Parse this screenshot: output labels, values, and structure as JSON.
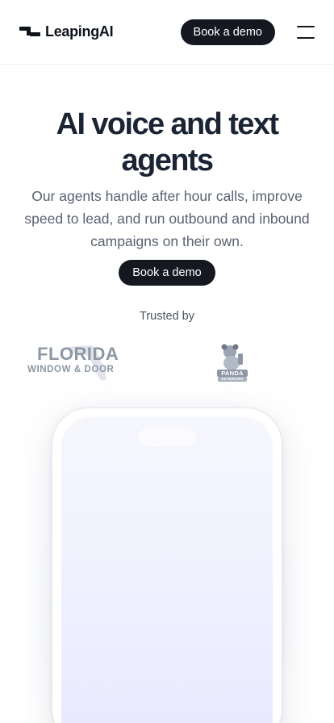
{
  "header": {
    "brand": "LeapingAI",
    "cta_label": "Book a demo",
    "menu_icon": "hamburger-menu-icon"
  },
  "hero": {
    "title": "AI voice and text agents",
    "subtitle": "Our agents handle after hour calls, improve speed to lead, and run outbound and inbound campaigns on their own.",
    "cta_label": "Book a demo"
  },
  "trusted": {
    "label": "Trusted by",
    "logos": [
      {
        "top": "FLORIDA",
        "bottom": "WINDOW & DOOR"
      },
      {
        "top": "PANDA",
        "bottom": "EXTERIORS"
      }
    ]
  },
  "colors": {
    "primary_dark": "#151821",
    "title_text": "#1b2434",
    "body_text": "#5a6270",
    "logo_gray": "#8e97a6",
    "phone_screen_start": "#f6f7fd",
    "phone_screen_end": "#e7e8fd"
  }
}
